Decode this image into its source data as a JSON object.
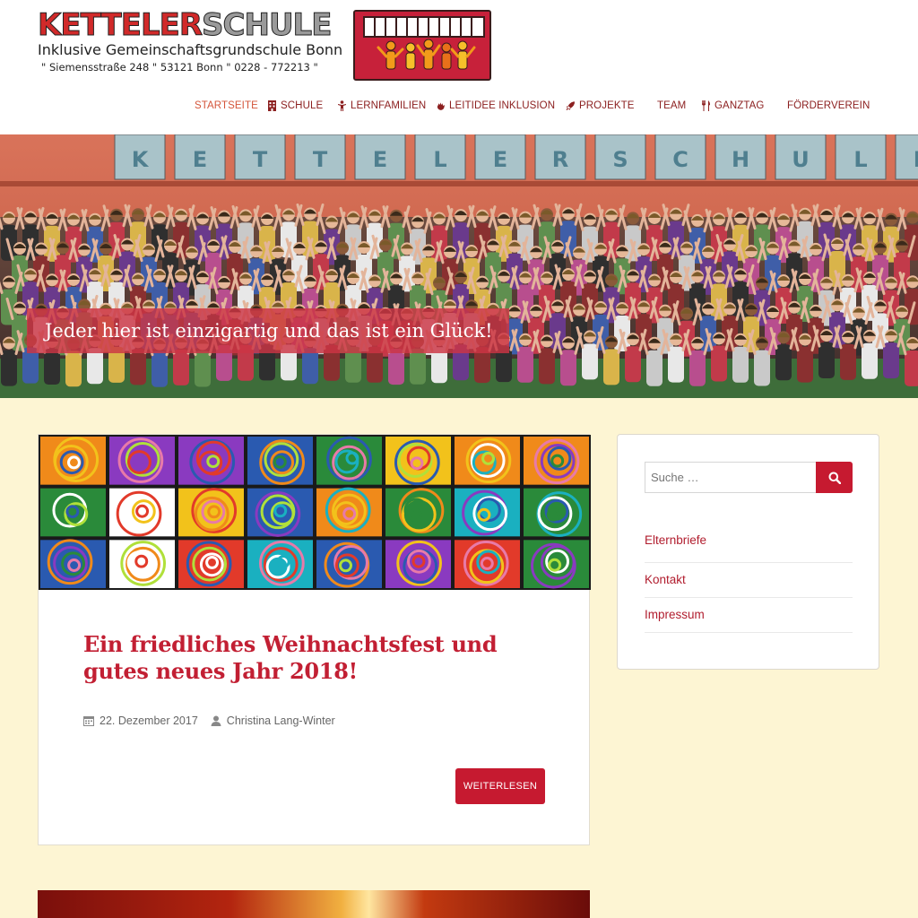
{
  "header": {
    "logo": {
      "title_part1": "KETTELER",
      "title_part2": "SCHULE",
      "subtitle": "Inklusive Gemeinschaftsgrundschule Bonn",
      "address": "\" Siemensstraße 248 \" 53121 Bonn \" 0228 - 772213 \""
    },
    "nav": [
      {
        "label": "STARTSEITE",
        "icon": ""
      },
      {
        "label": "SCHULE",
        "icon": "building-icon"
      },
      {
        "label": "LERNFAMILIEN",
        "icon": "child-icon"
      },
      {
        "label": "LEITIDEE INKLUSION",
        "icon": "hand-icon"
      },
      {
        "label": "PROJEKTE",
        "icon": "rocket-icon"
      },
      {
        "label": "TEAM",
        "icon": ""
      },
      {
        "label": "GANZTAG",
        "icon": "cutlery-icon"
      },
      {
        "label": "FÖRDERVEREIN",
        "icon": ""
      }
    ]
  },
  "hero": {
    "tagline": "Jeder hier ist einzigartig und das ist ein Glück!",
    "window_letters": [
      "K",
      "E",
      "T",
      "T",
      "E",
      "L",
      "E",
      "R",
      "S",
      "C",
      "H",
      "U",
      "L",
      "E"
    ]
  },
  "post": {
    "title": "Ein friedliches Weihnachtsfest und gutes neues Jahr 2018!",
    "date": "22. Dezember 2017",
    "author": "Christina Lang-Winter",
    "more_label": "WEITERLESEN"
  },
  "sidebar": {
    "search_placeholder": "Suche …",
    "links": [
      "Elternbriefe",
      "Kontakt",
      "Impressum"
    ]
  },
  "colors": {
    "accent": "#c61a30",
    "background": "#fdf5d3",
    "nav_active": "#d4553a"
  }
}
